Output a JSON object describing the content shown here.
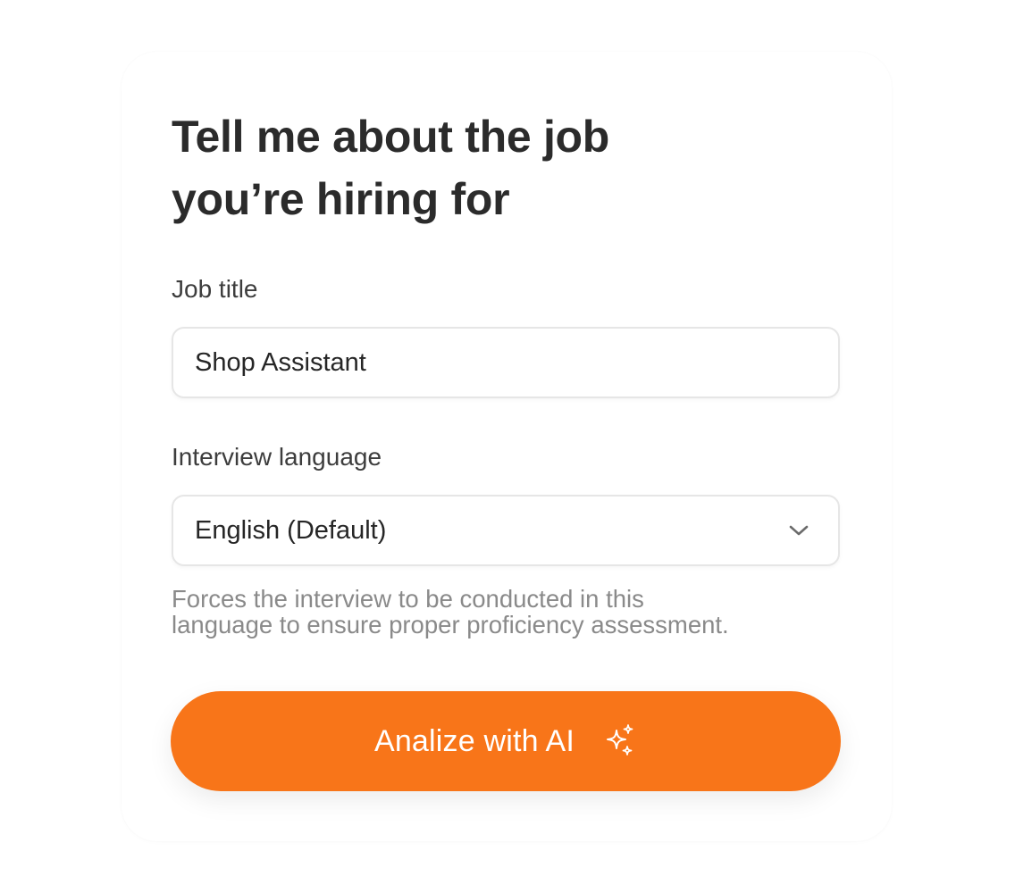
{
  "form": {
    "title_line1": "Tell me about the job",
    "title_line2": "you’re hiring for",
    "job_title": {
      "label": "Job title",
      "value": "Shop Assistant"
    },
    "interview_language": {
      "label": "Interview language",
      "selected": "English (Default)",
      "icon": "chevron-down-icon",
      "helper_line1": "Forces the interview to be conducted in this",
      "helper_line2": "language to ensure proper proficiency assessment."
    },
    "submit": {
      "label": "Analize with AI",
      "icon": "sparkles-icon"
    }
  },
  "colors": {
    "accent": "#f87519",
    "title": "#2b2b2b",
    "helper": "#8a8a8a",
    "border": "#e6e6e6"
  }
}
